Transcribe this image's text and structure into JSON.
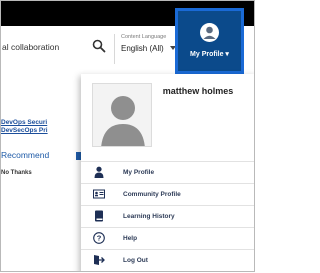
{
  "search": {
    "value": "al collaboration"
  },
  "language": {
    "label": "Content Language",
    "selected": "English (All)"
  },
  "profile_button": {
    "label": "My Profile"
  },
  "left_panel": {
    "links": [
      "DevOps Securi",
      "DevSecOps Pri"
    ],
    "recommend_label": "Recommend",
    "no_thanks_label": "No Thanks"
  },
  "dropdown": {
    "user_name": "matthew holmes",
    "items": [
      {
        "label": "My Profile",
        "icon": "person-icon"
      },
      {
        "label": "Community Profile",
        "icon": "id-card-icon"
      },
      {
        "label": "Learning History",
        "icon": "book-icon"
      },
      {
        "label": "Help",
        "icon": "help-icon"
      },
      {
        "label": "Log Out",
        "icon": "logout-icon"
      }
    ]
  },
  "colors": {
    "topbar": "#000000",
    "profile_button_bg": "#0b4a8b",
    "profile_highlight": "#1a6ad6",
    "link": "#1b4e9b",
    "menu_text": "#2d3b57"
  }
}
